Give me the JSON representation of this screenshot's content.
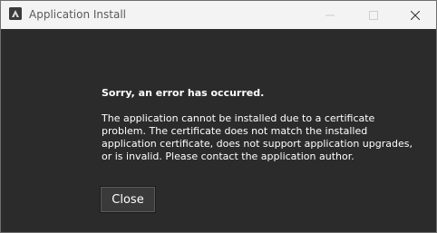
{
  "window": {
    "title": "Application Install",
    "icon": "adobe-air-icon",
    "controls": [
      "minimize-icon",
      "maximize-icon",
      "close-icon"
    ]
  },
  "dialog": {
    "heading": "Sorry, an error has occurred.",
    "message_lines": [
      "The application cannot be installed due to a certificate",
      "problem.  The certificate does not match the installed",
      "application certificate, does not support application upgrades,",
      "or is invalid.  Please contact the application author."
    ],
    "close_label": "Close"
  },
  "colors": {
    "titlebar": "#f3f3f3",
    "content_background": "#2b2b2b",
    "text": "#ffffff"
  }
}
